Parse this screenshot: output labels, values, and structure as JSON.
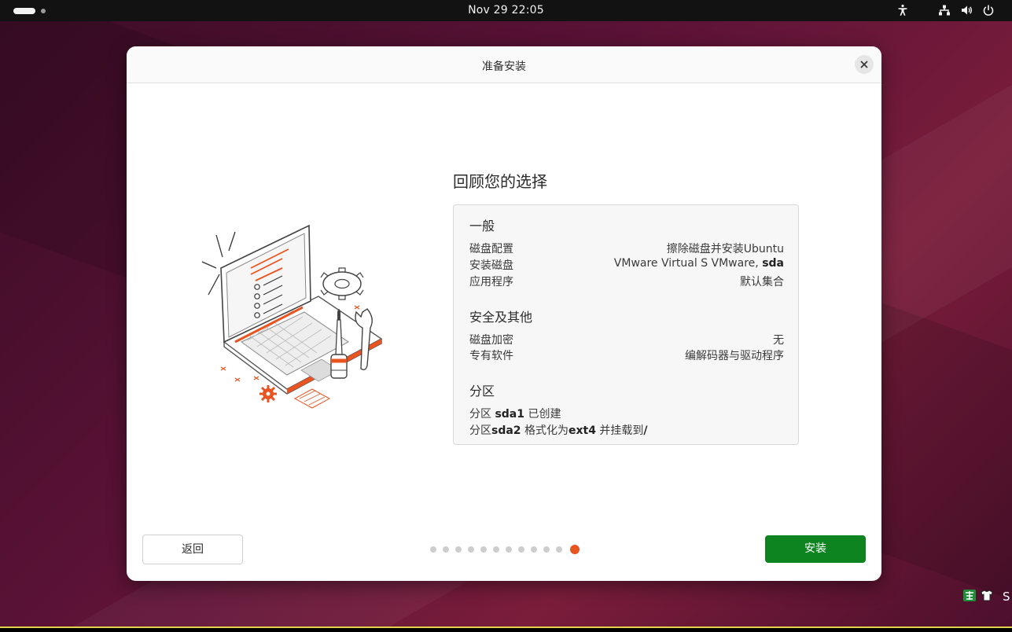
{
  "topbar": {
    "clock": "Nov 29  22:05",
    "icons": [
      "workspace-indicator",
      "accessibility-icon",
      "network-icon",
      "volume-icon",
      "power-icon"
    ]
  },
  "dialog": {
    "title": "准备安装",
    "close_icon": "close-icon"
  },
  "review": {
    "title": "回顾您的选择",
    "general": {
      "title": "一般",
      "rows": [
        {
          "key": "磁盘配置",
          "value": "擦除磁盘并安装Ubuntu"
        },
        {
          "key": "安装磁盘",
          "value_prefix": "VMware Virtual S VMware, ",
          "value_bold": "sda"
        },
        {
          "key": "应用程序",
          "value": "默认集合"
        }
      ]
    },
    "security": {
      "title": "安全及其他",
      "rows": [
        {
          "key": "磁盘加密",
          "value": "无"
        },
        {
          "key": "专有软件",
          "value": "编解码器与驱动程序"
        }
      ]
    },
    "partitions": {
      "title": "分区",
      "line1": {
        "a": "分区 ",
        "b": "sda1",
        "c": " 已创建"
      },
      "line2": {
        "a": "分区",
        "b": "sda2",
        "c": " 格式化为",
        "d": "ext4",
        "e": " 并挂载到",
        "f": "/"
      }
    }
  },
  "footer": {
    "back_label": "返回",
    "install_label": "安装",
    "steps_total": 12,
    "steps_current": 12
  },
  "colors": {
    "accent": "#e95420",
    "install_green": "#0e8420"
  }
}
